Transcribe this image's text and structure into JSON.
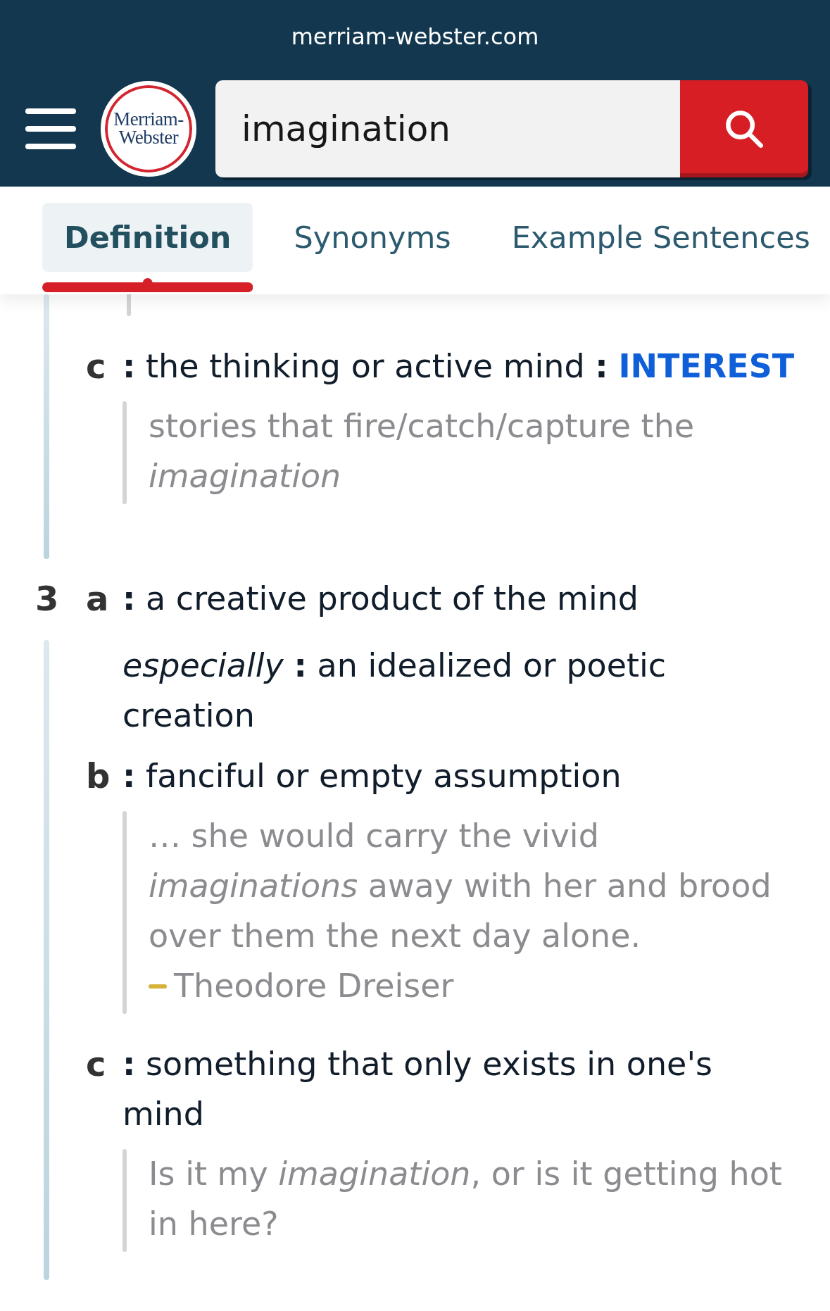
{
  "browser": {
    "url": "merriam-webster.com"
  },
  "header": {
    "logo": "Merriam-Webster",
    "search": {
      "value": "imagination"
    }
  },
  "tabs": [
    {
      "label": "Definition",
      "selected": true
    },
    {
      "label": "Synonyms",
      "selected": false
    },
    {
      "label": "Example Sentences",
      "selected": false
    }
  ],
  "senses": [
    {
      "subsenses": [
        {
          "letter": "c",
          "definition": "**:** the thinking or active mind **:**",
          "crossref": "INTEREST",
          "examples": [
            {
              "text": "stories that fire/catch/capture the *imagination*"
            }
          ]
        }
      ]
    },
    {
      "number": "3",
      "subsenses": [
        {
          "letter": "a",
          "definition": "**:** a creative product of the mind",
          "note": "*especially* **:** an idealized or poetic creation"
        },
        {
          "letter": "b",
          "definition": "**:** fanciful or empty assumption",
          "examples": [
            {
              "text": "… she would carry the vivid *imaginations* away with her and brood over them the next day alone.",
              "author": "Theodore Dreiser"
            }
          ]
        },
        {
          "letter": "c",
          "definition": "**:** something that only exists in one's mind",
          "examples": [
            {
              "text": "Is it my *imagination*, or is it getting hot in here?"
            }
          ]
        }
      ]
    }
  ]
}
